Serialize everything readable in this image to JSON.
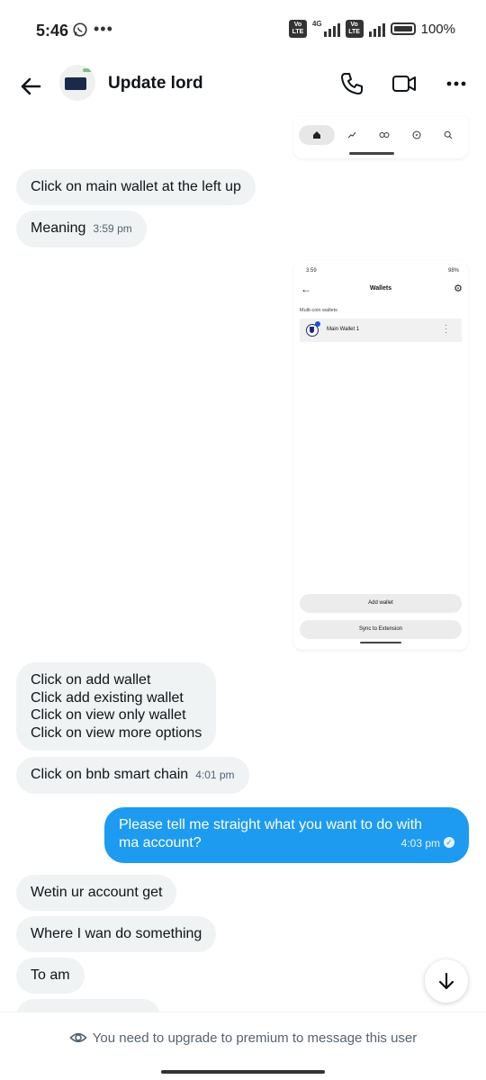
{
  "status_bar": {
    "time": "5:46",
    "dots": "•••",
    "volte": "Vo LTE",
    "network": "4G",
    "battery": "100%"
  },
  "header": {
    "title": "Update lord"
  },
  "messages": {
    "m1": "Click on main wallet at the left up",
    "m2": "Meaning",
    "m2_time": "3:59 pm",
    "m3_l1": "Click on add wallet",
    "m3_l2": "Click add existing wallet",
    "m3_l3": "Click on view only wallet",
    "m3_l4": "Click on view more options",
    "m4": "Click on bnb smart chain",
    "m4_time": "4:01 pm",
    "m5_l1": "Please tell me straight what you want to do with",
    "m5_l2": "ma account?",
    "m5_time": "4:03 pm",
    "m6": "Wetin ur account get",
    "m7": "Where I wan do something",
    "m8": "To am"
  },
  "image2": {
    "time": "3:59",
    "status": "98%",
    "title": "Wallets",
    "section": "Multi-coin wallets",
    "wallet_name": "Main Wallet 1",
    "add_wallet": "Add wallet",
    "sync": "Sync to Extension"
  },
  "footer": {
    "premium_text": "You need to upgrade to premium to message this user"
  },
  "colors": {
    "accent": "#1d9bf0",
    "incoming_bubble": "#eff3f4"
  }
}
